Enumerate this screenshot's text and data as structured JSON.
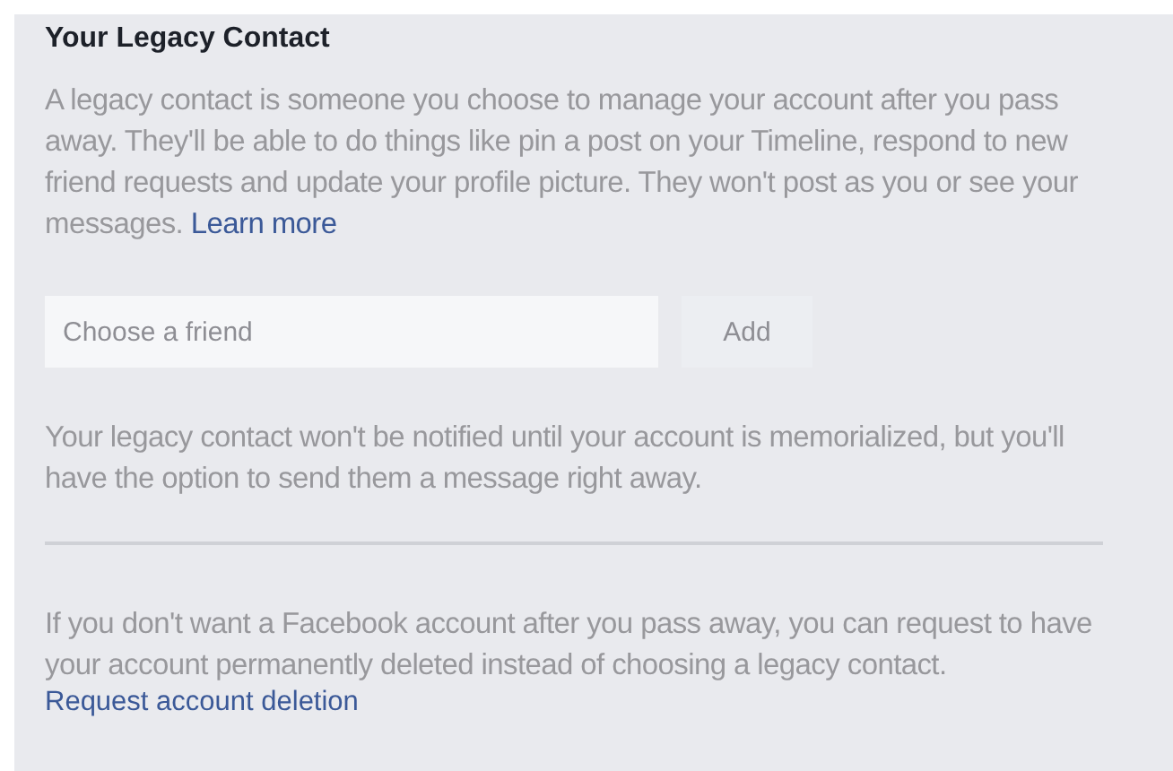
{
  "section": {
    "title": "Your Legacy Contact",
    "description": "A legacy contact is someone you choose to manage your account after you pass away. They'll be able to do things like pin a post on your Timeline, respond to new friend requests and update your profile picture. They won't post as you or see your messages.",
    "learn_more_link": "Learn more",
    "friend_field": {
      "placeholder": "Choose a friend"
    },
    "add_button": "Add",
    "notice": "Your legacy contact won't be notified until your account is memorialized, but you'll have the option to send them a message right away.",
    "deletion_text": "If you don't want a Facebook account after you pass away, you can request to have your account permanently deleted instead of choosing a legacy contact.",
    "deletion_link": "Request account deletion"
  }
}
